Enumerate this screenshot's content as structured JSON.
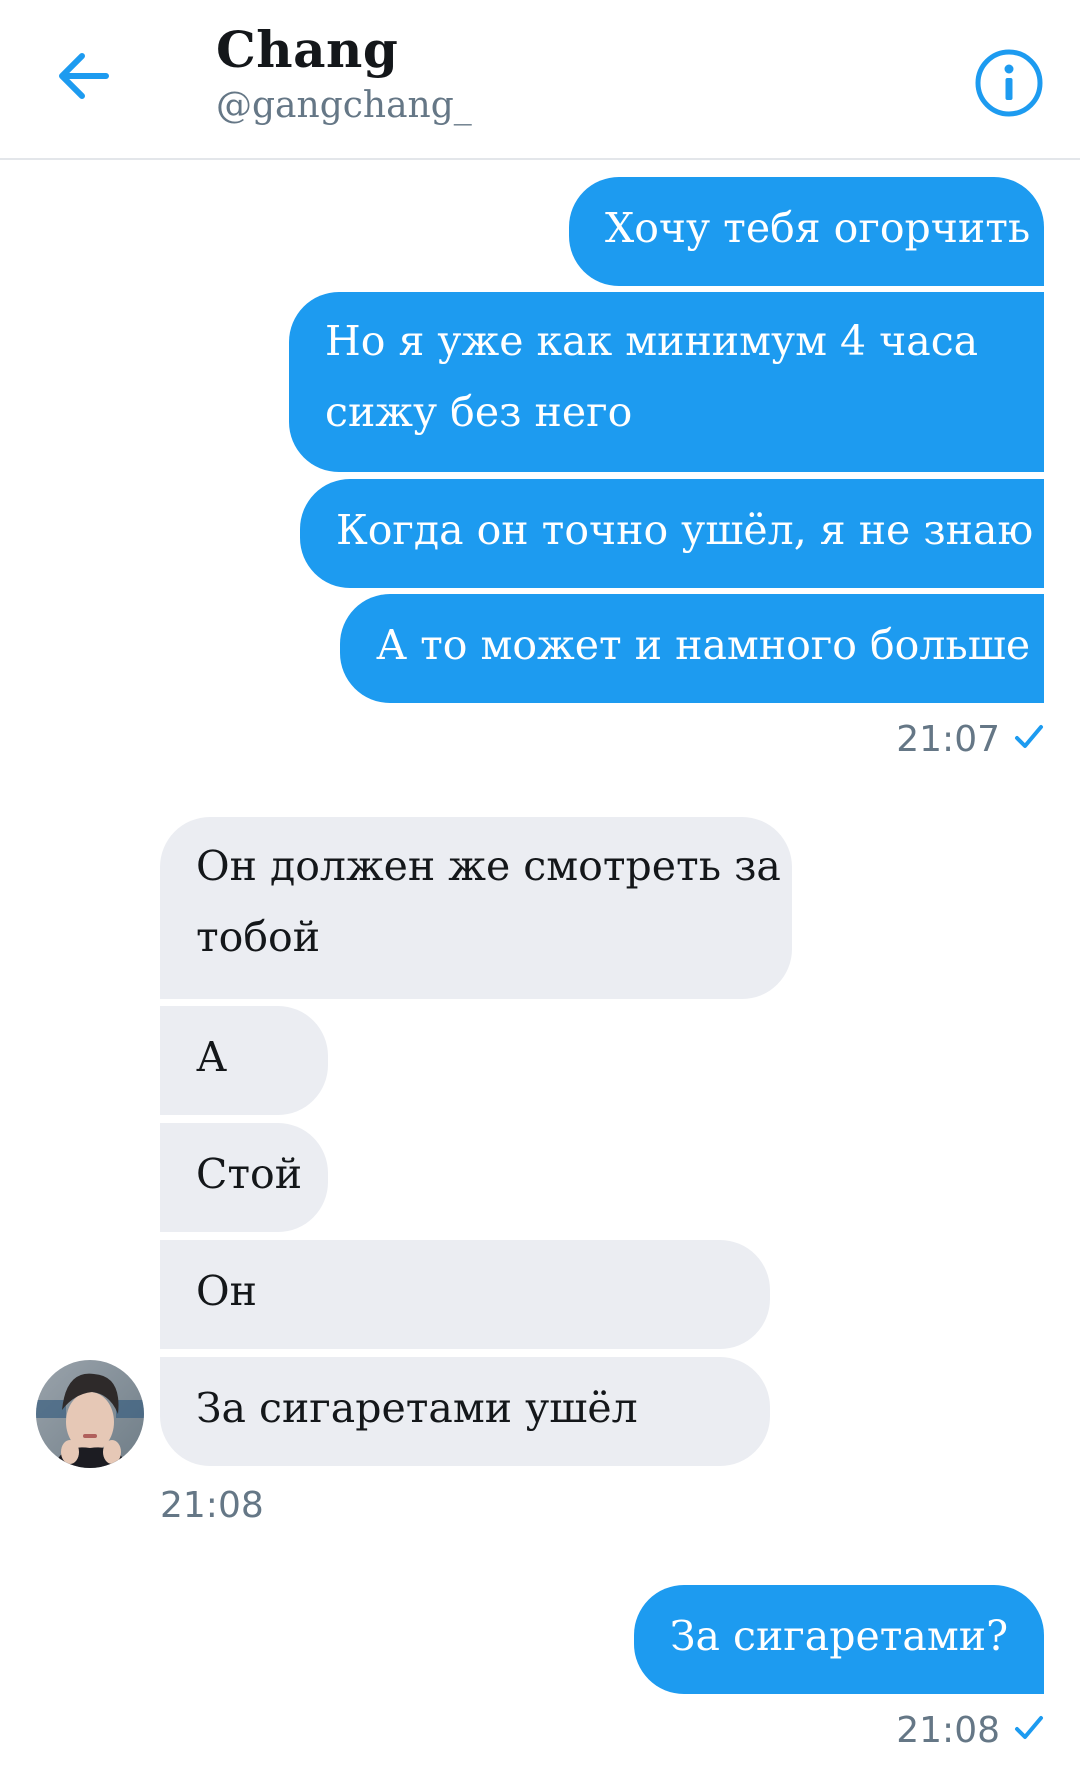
{
  "header": {
    "name": "Chang",
    "handle": "@gangchang_"
  },
  "icons": {
    "back": "back-arrow-icon",
    "info": "info-icon",
    "read_receipt": "check-icon"
  },
  "colors": {
    "accent": "#1d9bf0",
    "incoming_bubble": "#ebedf2",
    "meta_text": "#657786"
  },
  "messages": {
    "group1": [
      "Хочу тебя огорчить",
      "Но я уже как минимум 4 часа",
      "сижу без него",
      "Когда он точно ушёл, я не знаю",
      "А то может и намного больше"
    ],
    "group1_time": "21:07",
    "group2": [
      "Он должен же смотреть за",
      "тобой",
      "А",
      "Стой",
      "Он",
      "За сигаретами ушёл"
    ],
    "group2_time": "21:08",
    "group3": [
      "За сигаретами?"
    ],
    "group3_time": "21:08"
  }
}
